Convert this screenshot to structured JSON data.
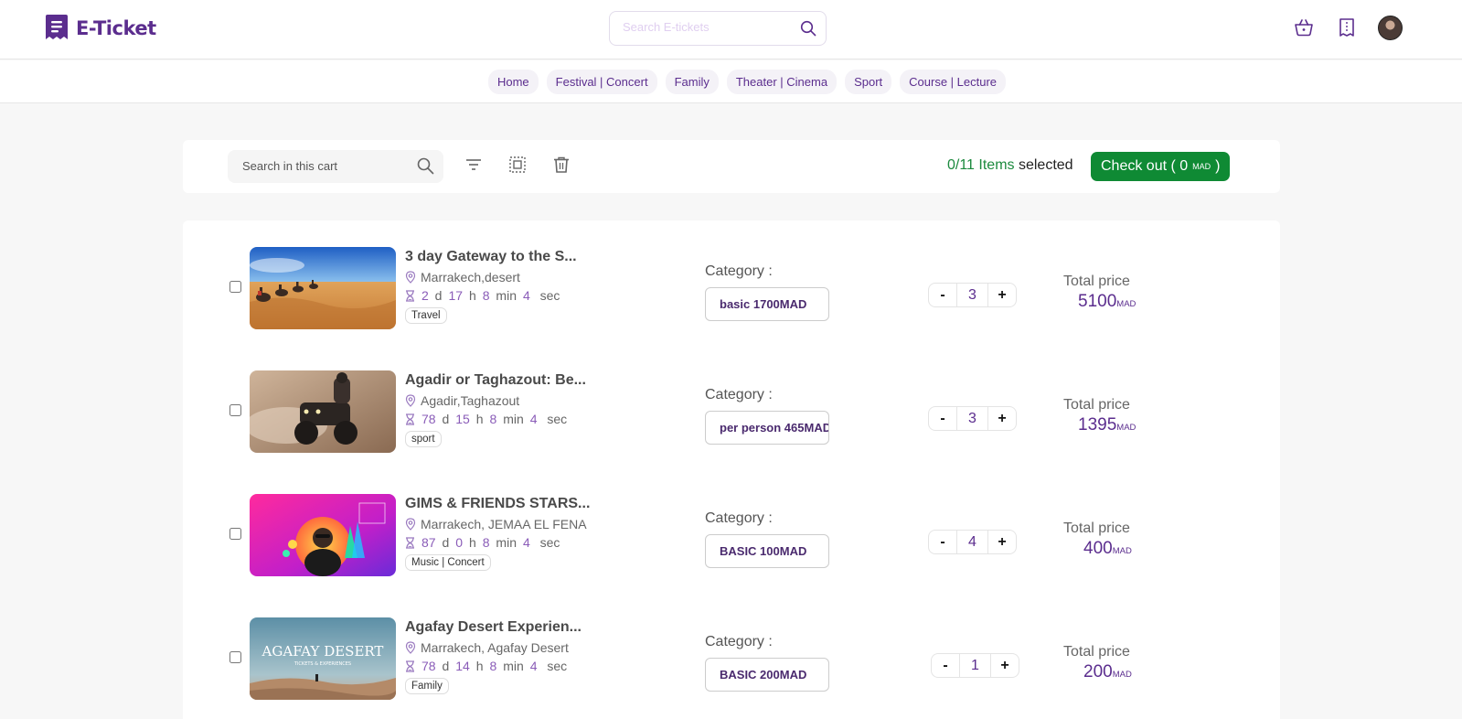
{
  "app": {
    "name": "E-Ticket",
    "search_placeholder": "Search E-tickets"
  },
  "header_icons": [
    "basket-icon",
    "ticket-bookmark-icon",
    "user-avatar"
  ],
  "nav": {
    "items": [
      {
        "label": "Home"
      },
      {
        "label": "Festival | Concert"
      },
      {
        "label": "Family"
      },
      {
        "label": "Theater | Cinema"
      },
      {
        "label": "Sport"
      },
      {
        "label": "Course | Lecture"
      }
    ]
  },
  "cart": {
    "search_placeholder": "Search in this cart",
    "selected_count": "0/11 Items",
    "selected_suffix": "selected",
    "checkout": {
      "prefix": "Check out ( 0",
      "unit": "MAD",
      "suffix": ")"
    },
    "category_label": "Category :",
    "total_label": "Total price",
    "currency": "MAD",
    "items": [
      {
        "title": "3 day Gateway to the S...",
        "location": "Marrakech,desert",
        "countdown": {
          "d": "2",
          "h": "17",
          "min": "8",
          "sec": "4"
        },
        "tag": "Travel",
        "category": "basic 1700MAD",
        "quantity": "3",
        "total": "5100",
        "thumb_theme": "desert-camels"
      },
      {
        "title": "Agadir or Taghazout: Be...",
        "location": "Agadir,Taghazout",
        "countdown": {
          "d": "78",
          "h": "15",
          "min": "8",
          "sec": "4"
        },
        "tag": "sport",
        "category": "per person 465MAD",
        "quantity": "3",
        "total": "1395",
        "thumb_theme": "quad-bike"
      },
      {
        "title": "GIMS & FRIENDS STARS...",
        "location": "Marrakech, JEMAA EL FENA",
        "countdown": {
          "d": "87",
          "h": "0",
          "min": "8",
          "sec": "4"
        },
        "tag": "Music | Concert",
        "category": "BASIC 100MAD",
        "quantity": "4",
        "total": "400",
        "thumb_theme": "concert-poster"
      },
      {
        "title": "Agafay Desert Experien...",
        "location": "Marrakech, Agafay Desert",
        "countdown": {
          "d": "78",
          "h": "14",
          "min": "8",
          "sec": "4"
        },
        "tag": "Family",
        "category": "BASIC 200MAD",
        "quantity": "1",
        "total": "200",
        "thumb_theme": "agafay-desert",
        "thumb_text": "AGAFAY DESERT",
        "thumb_subtext": "TICKETS & EXPERIENCES"
      }
    ]
  },
  "colors": {
    "brand": "#5b2d8e",
    "checkout_green": "#0f8a34",
    "selected_green": "#1c8a3e"
  }
}
